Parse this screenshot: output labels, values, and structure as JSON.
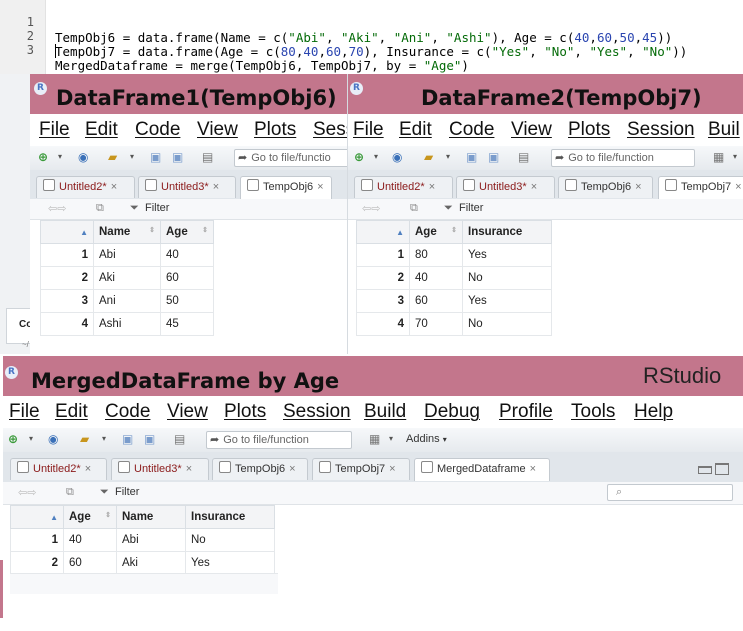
{
  "code_editor": {
    "lines": [
      {
        "num": "1",
        "text": "TempObj6 = data.frame(Name = c(\"Abi\", \"Aki\", \"Ani\", \"Ashi\"), Age = c(40,60,50,45))"
      },
      {
        "num": "2",
        "text": "TempObj7 = data.frame(Age = c(80,40,60,70), Insurance = c(\"Yes\", \"No\", \"Yes\", \"No\"))"
      },
      {
        "num": "3",
        "text": "MergedDataframe = merge(TempObj6, TempObj7, by = \"Age\")"
      }
    ]
  },
  "left_side_labels": {
    "co": "Co",
    "tilde": "~/"
  },
  "window1": {
    "logo": "R",
    "title": "DataFrame1(TempObj6)",
    "menu": [
      "File",
      "Edit",
      "Code",
      "View",
      "Plots",
      "Sess"
    ],
    "goto_placeholder": "Go to file/functio",
    "tabs": [
      "Untitled2*",
      "Untitled3*",
      "TempObj6"
    ],
    "filter_label": "Filter",
    "columns": [
      "Name",
      "Age"
    ],
    "rows": [
      {
        "n": "1",
        "cells": [
          "Abi",
          "40"
        ]
      },
      {
        "n": "2",
        "cells": [
          "Aki",
          "60"
        ]
      },
      {
        "n": "3",
        "cells": [
          "Ani",
          "50"
        ]
      },
      {
        "n": "4",
        "cells": [
          "Ashi",
          "45"
        ]
      }
    ]
  },
  "window2": {
    "logo": "R",
    "title": "DataFrame2(TempObj7)",
    "menu": [
      "File",
      "Edit",
      "Code",
      "View",
      "Plots",
      "Session",
      "Buil"
    ],
    "goto_placeholder": "Go to file/function",
    "tabs": [
      "Untitled2*",
      "Untitled3*",
      "TempObj6",
      "TempObj7"
    ],
    "filter_label": "Filter",
    "columns": [
      "Age",
      "Insurance"
    ],
    "rows": [
      {
        "n": "1",
        "cells": [
          "80",
          "Yes"
        ]
      },
      {
        "n": "2",
        "cells": [
          "40",
          "No"
        ]
      },
      {
        "n": "3",
        "cells": [
          "60",
          "Yes"
        ]
      },
      {
        "n": "4",
        "cells": [
          "70",
          "No"
        ]
      }
    ]
  },
  "window3": {
    "logo": "R",
    "title": "MergedDataFrame by Age",
    "app_name": "RStudio",
    "menu": [
      "File",
      "Edit",
      "Code",
      "View",
      "Plots",
      "Session",
      "Build",
      "Debug",
      "Profile",
      "Tools",
      "Help"
    ],
    "goto_placeholder": "Go to file/function",
    "addins_label": "Addins",
    "tabs": [
      "Untitled2*",
      "Untitled3*",
      "TempObj6",
      "TempObj7",
      "MergedDataframe"
    ],
    "filter_label": "Filter",
    "columns": [
      "Age",
      "Name",
      "Insurance"
    ],
    "rows": [
      {
        "n": "1",
        "cells": [
          "40",
          "Abi",
          "No"
        ]
      },
      {
        "n": "2",
        "cells": [
          "60",
          "Aki",
          "Yes"
        ]
      }
    ]
  },
  "icons": {
    "sort": "sort-arrows-icon",
    "filter": "funnel-icon",
    "search": "search-icon",
    "close": "close-icon",
    "table": "table-icon",
    "doc": "r-document-icon"
  }
}
